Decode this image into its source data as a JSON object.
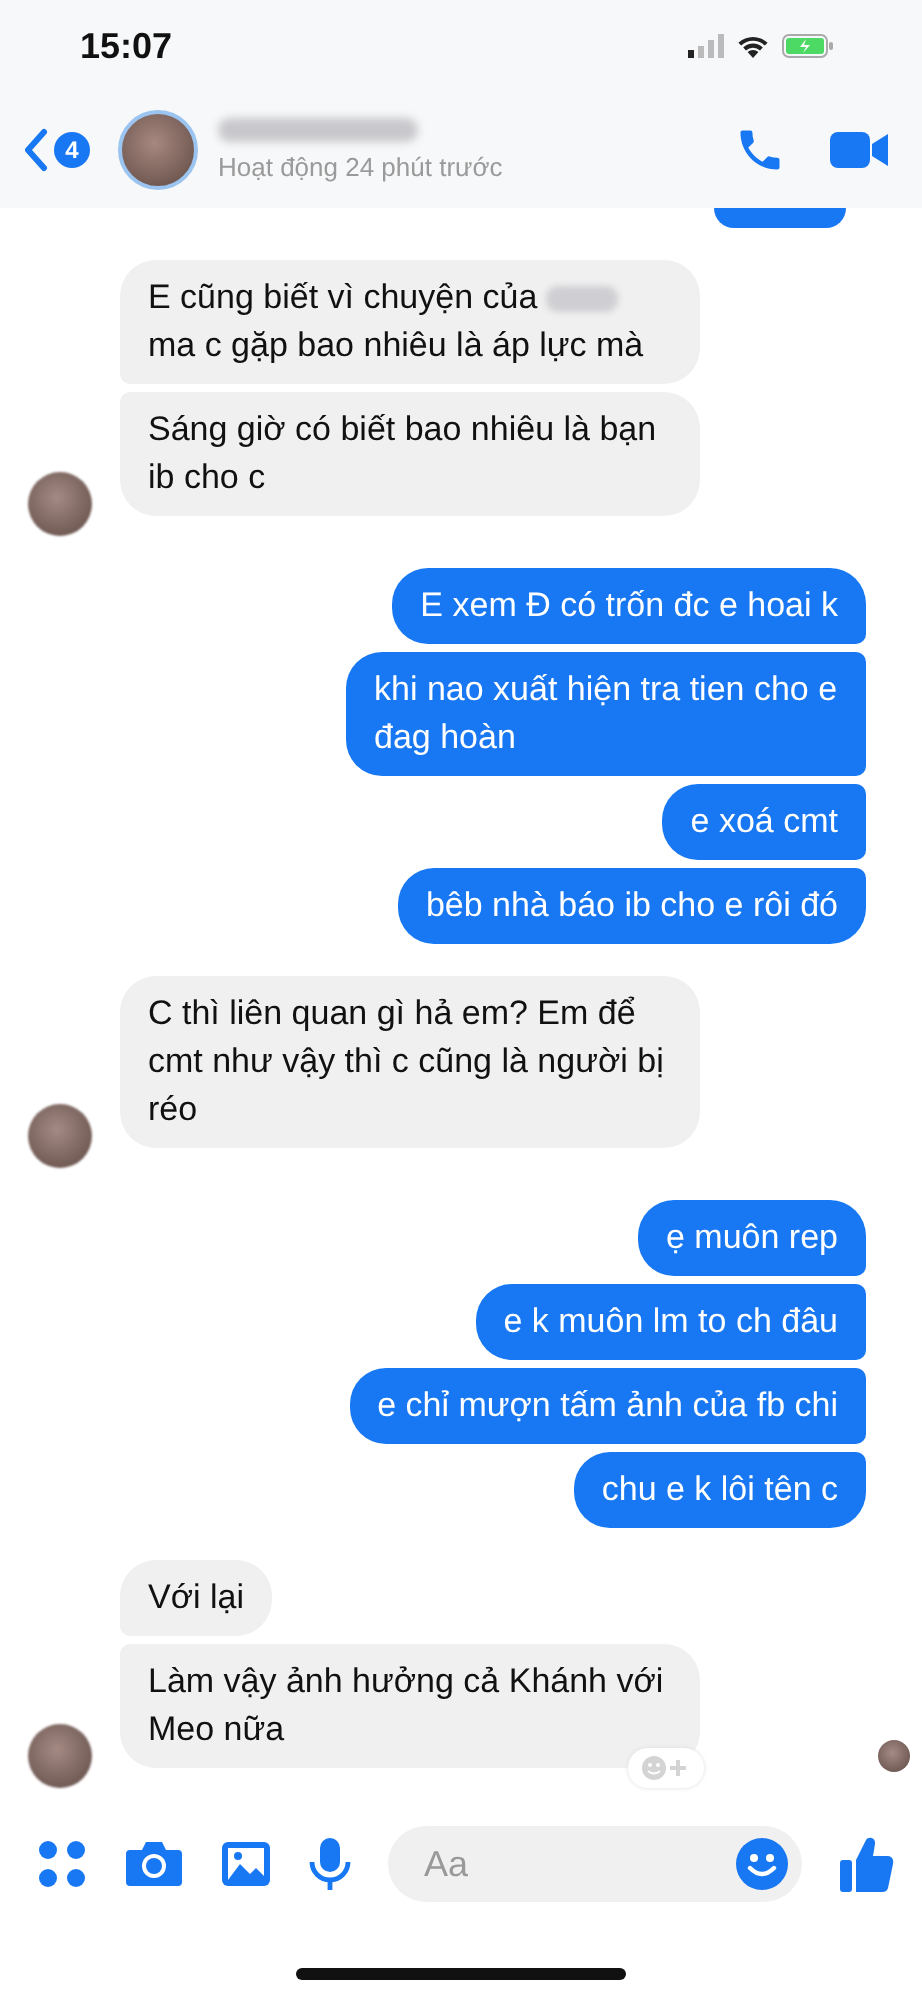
{
  "status_bar": {
    "time": "15:07"
  },
  "header": {
    "back_count": "4",
    "status": "Hoạt động 24 phút trước"
  },
  "groups": [
    {
      "kind": "received",
      "messages": [
        {
          "parts": [
            {
              "kind": "text",
              "text": "E cũng biết vì chuyện của "
            },
            {
              "kind": "redacted"
            },
            {
              "kind": "text",
              "text": " ma c gặp bao nhiêu là áp lực mà"
            }
          ]
        },
        {
          "parts": [
            {
              "kind": "text",
              "text": "Sáng giờ có biết bao nhiêu là bạn ib cho c"
            }
          ]
        }
      ]
    },
    {
      "kind": "sent",
      "messages": [
        {
          "parts": [
            {
              "kind": "text",
              "text": "E xem Đ có trốn đc e hoai k"
            }
          ]
        },
        {
          "parts": [
            {
              "kind": "text",
              "text": "khi nao xuất hiện tra tien cho e đag hoàn"
            }
          ]
        },
        {
          "parts": [
            {
              "kind": "text",
              "text": "e xoá cmt"
            }
          ]
        },
        {
          "parts": [
            {
              "kind": "text",
              "text": "bêb nhà báo ib cho e rôi đó"
            }
          ]
        }
      ]
    },
    {
      "kind": "received",
      "messages": [
        {
          "parts": [
            {
              "kind": "text",
              "text": "C thì liên quan gì hả em? Em để cmt như vậy thì c cũng là người bị réo"
            }
          ]
        }
      ]
    },
    {
      "kind": "sent",
      "messages": [
        {
          "parts": [
            {
              "kind": "text",
              "text": "ẹ muôn rep"
            }
          ]
        },
        {
          "parts": [
            {
              "kind": "text",
              "text": "e k muôn lm to ch đâu"
            }
          ]
        },
        {
          "parts": [
            {
              "kind": "text",
              "text": "e chỉ mượn tấm ảnh của fb chi"
            }
          ]
        },
        {
          "parts": [
            {
              "kind": "text",
              "text": "chu e k lôi tên c"
            }
          ]
        }
      ]
    },
    {
      "kind": "received",
      "messages": [
        {
          "parts": [
            {
              "kind": "text",
              "text": "Với lại"
            }
          ]
        },
        {
          "parts": [
            {
              "kind": "text",
              "text": "Làm vậy ảnh hưởng cả Khánh với Meo nữa"
            }
          ],
          "react_button": true
        }
      ]
    }
  ],
  "composer": {
    "placeholder": "Aa"
  }
}
